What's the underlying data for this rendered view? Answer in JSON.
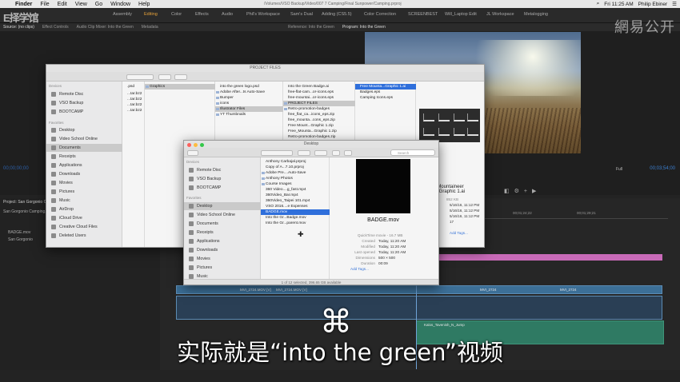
{
  "menubar": {
    "items": [
      "Finder",
      "File",
      "Edit",
      "View",
      "Go",
      "Window",
      "Help"
    ],
    "center_path": "/Volumes/VSO Backup/Video/007 7 Camping/Final Sunpower/Camping.prproj",
    "time": "Fri 11:25 AM",
    "user": "Philip Ebiner"
  },
  "workspaces": [
    "Assembly",
    "Editing",
    "Color",
    "Effects",
    "Audio",
    "Phil's Workspace",
    "Sam's Dual",
    "Adding (CS5.5)",
    "Color Correction",
    "SCREENBEST",
    "Will_Laptop Edit",
    "JL Workspace",
    "Metalogging"
  ],
  "watermark": {
    "left": "E择学馆",
    "right": "網易公开"
  },
  "source_panel": {
    "tabs": [
      "Source: (no clips)",
      "Effect Controls",
      "Audio Clip Mixer: Into the Green",
      "Metadata"
    ],
    "timecode": "00;00;00;00"
  },
  "program_panel": {
    "tabs": [
      "Reference: Into the Green",
      "Program: Into the Green"
    ],
    "timecode": "00;03;54;00",
    "fit": "Full"
  },
  "project_panel": {
    "title": "Project: San Gorgonio Camping",
    "rows": [
      "San Gorgonio Camping.prproj",
      "BADGE.mov",
      "San Gorgonio"
    ]
  },
  "timeline": {
    "ruler": [
      "00;01;24;22",
      "00;01;29;21"
    ],
    "clip_labels": [
      "MVI_2724.MOV [V]",
      "MVI_2724.MOV [V]",
      "MVI_2724",
      "MVI_2724"
    ],
    "green_clip": "Kalos_Tavenish_N_Jump"
  },
  "finder_back": {
    "title": "PROJECT FILES",
    "sidebar_devices_header": "Devices",
    "sidebar_devices": [
      "Remote Disc",
      "VSO Backup",
      "BOOTCAMP"
    ],
    "sidebar_favorites_header": "Favorites",
    "sidebar_favorites": [
      "Desktop",
      "Video School Online",
      "Documents",
      "Receipts",
      "Applications",
      "Downloads",
      "Movies",
      "Pictures",
      "Music",
      "AirDrop",
      "iCloud Drive",
      "Creative Cloud Files",
      "Deleted Users"
    ],
    "col1": [
      ".psd",
      "...tar.bz2",
      "...tar.bz2",
      "...tar.bz2",
      "...tar.bz2"
    ],
    "col2": [
      "Graphics"
    ],
    "col3": [
      "into the green logo.psd",
      "Adobe After...ts Auto-Save",
      "Bumper",
      "icons",
      "Illustrator Files",
      "YT Thumbnails"
    ],
    "col4": [
      "Into the Green Badge.ai",
      "free-flat-cam...or-icons.eps",
      "free-mountai...or-icons.eps",
      "PROJECT FILES",
      "Retro-promotion-badges",
      "free_flat_ca...icons_eps.zip",
      "free_mounta...cons_eps.zip",
      "Free Mount...Graphic 1.zip",
      "Free_Mounta...Graphic 1.zip",
      "Retro-promotion-badges.zip"
    ],
    "col5": [
      "Free Mounta...Graphic 1.ai",
      "Badges.eps",
      "Camping Icons.eps"
    ],
    "preview_title": "Mountaineer\nr Graphic 1.ai",
    "preview_size": "852 KB",
    "preview_meta": [
      "5/16/16, 11:12 PM",
      "5/16/16, 11:12 PM",
      "5/16/16, 11:12 PM",
      "17"
    ],
    "add_tags": "Add Tags..."
  },
  "finder_front": {
    "title": "Desktop",
    "search_placeholder": "Search",
    "sidebar_devices_header": "Devices",
    "sidebar_devices": [
      "Remote Disc",
      "VSO Backup",
      "BOOTCAMP"
    ],
    "sidebar_favorites_header": "Favorites",
    "sidebar_favorites": [
      "Desktop",
      "Video School Online",
      "Documents",
      "Receipts",
      "Applications",
      "Downloads",
      "Movies",
      "Pictures",
      "Music"
    ],
    "files": [
      "Anthony Carbajal.prproj",
      "Copy of A...7.10.prproj",
      "Adobe Pre....Auto-Save",
      "Anthony Photos",
      "Course Images",
      "360 Video....g_fast.mp4",
      "360Video_Bar.mp4",
      "360Video_Taipei 101.mp4",
      "VSO 2016....e Expenses",
      "BADGE.mov",
      "Into the Gr...Badge.mov",
      "Into the Gr...parent.mov"
    ],
    "preview_name": "BADGE.mov",
    "preview_kind": "QuickTime movie - 16.7 MB",
    "info": [
      {
        "k": "Created",
        "v": "Today, 11:20 AM"
      },
      {
        "k": "Modified",
        "v": "Today, 11:20 AM"
      },
      {
        "k": "Last opened",
        "v": "Today, 11:20 AM"
      },
      {
        "k": "Dimensions",
        "v": "500 × 500"
      },
      {
        "k": "Duration",
        "v": "00:09"
      }
    ],
    "add_tags": "Add Tags...",
    "status": "1 of 12 selected, 396.65 GB available"
  },
  "subtitle": "实际就是“into the green”视频",
  "overlay_glyph": "⌘"
}
